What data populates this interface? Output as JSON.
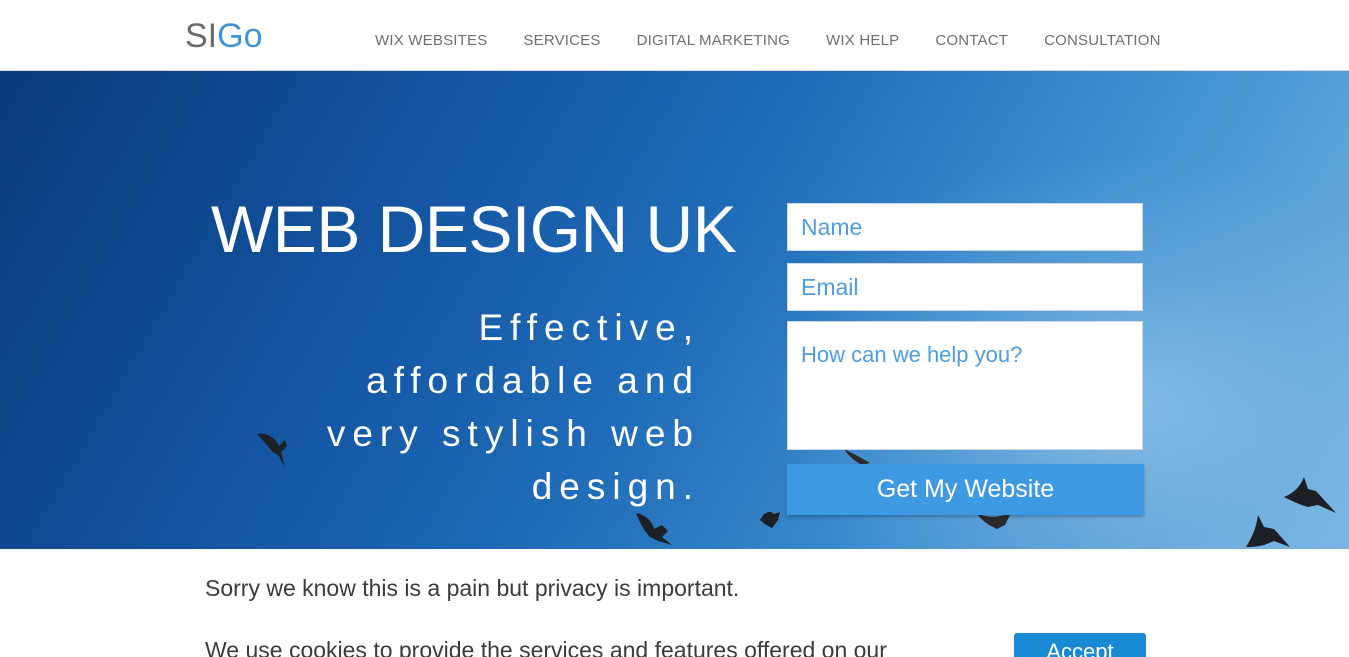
{
  "header": {
    "logo_part1": "SI",
    "logo_part2": "Go",
    "nav": [
      {
        "label": "WIX WEBSITES"
      },
      {
        "label": "SERVICES"
      },
      {
        "label": "DIGITAL MARKETING"
      },
      {
        "label": "WIX HELP"
      },
      {
        "label": "CONTACT"
      },
      {
        "label": "CONSULTATION"
      }
    ]
  },
  "hero": {
    "title": "WEB DESIGN UK",
    "subtitle_lines": [
      "Effective,",
      "affordable and",
      "very stylish web",
      "design."
    ]
  },
  "form": {
    "name_placeholder": "Name",
    "email_placeholder": "Email",
    "message_placeholder": "How can we help you?",
    "submit_label": "Get My Website"
  },
  "cookie": {
    "title": "Sorry we know this is a pain but privacy is important.",
    "body": "We use cookies to provide the services and features offered on our",
    "accept_label": "Accept"
  },
  "colors": {
    "accent": "#3f95d8",
    "button": "#3e99e3",
    "accept": "#1a8ad4"
  }
}
